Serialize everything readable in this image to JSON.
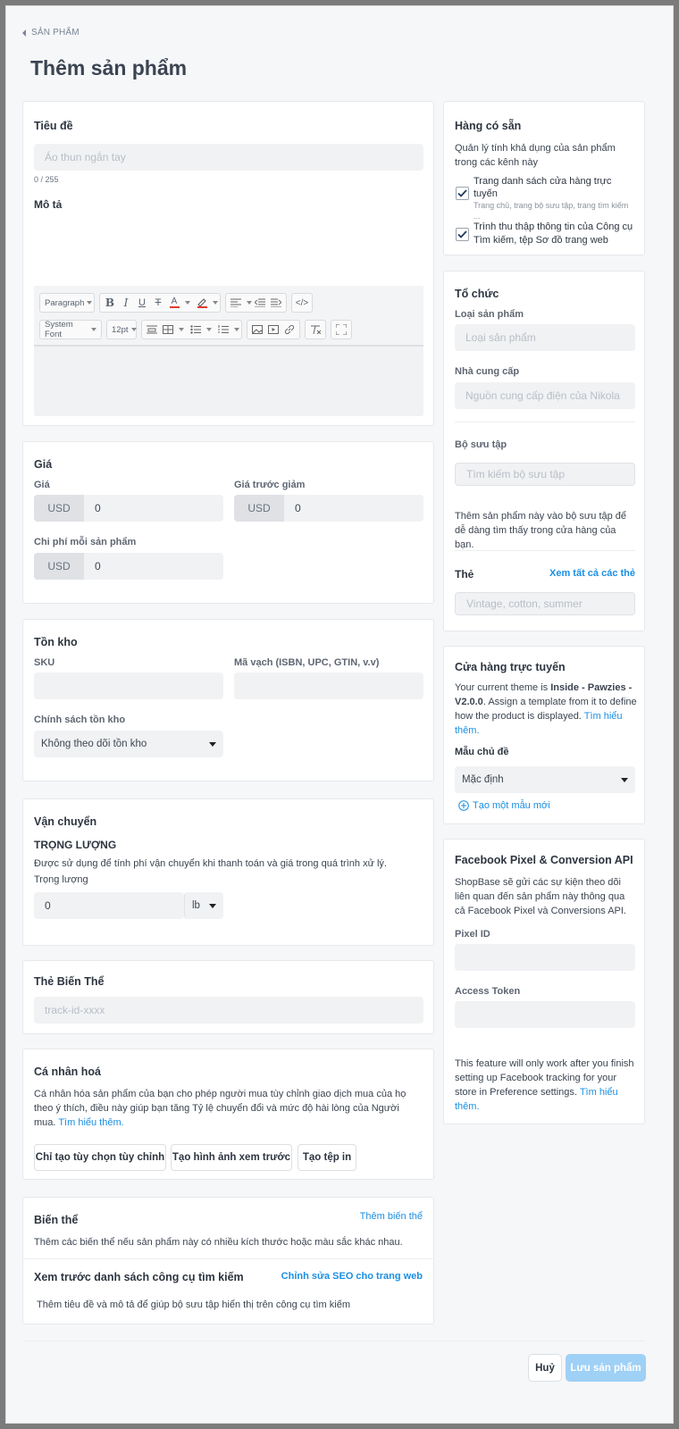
{
  "header": {
    "back_label": "SẢN PHẨM",
    "title": "Thêm sản phẩm"
  },
  "title_card": {
    "title_label": "Tiêu đề",
    "title_placeholder": "Áo thun ngắn tay",
    "char_count": "0 / 255",
    "description_label": "Mô tả",
    "toolbar": {
      "paragraph": "Paragraph",
      "font": "System Font",
      "size": "12pt"
    }
  },
  "pricing": {
    "heading": "Giá",
    "price_label": "Giá",
    "compare_label": "Giá trước giảm",
    "cost_label": "Chi phí mỗi sản phẩm",
    "currency": "USD",
    "price_value": "0",
    "compare_value": "0",
    "cost_value": "0"
  },
  "inventory": {
    "heading": "Tồn kho",
    "sku_label": "SKU",
    "barcode_label": "Mã vạch (ISBN, UPC, GTIN, v.v)",
    "policy_label": "Chính sách tồn kho",
    "policy_value": "Không theo dõi tồn kho"
  },
  "shipping": {
    "heading": "Vận chuyển",
    "weight_heading": "TRỌNG LƯỢNG",
    "help": "Được sử dụng để tính phí vận chuyển khi thanh toán và giá trong quá trình xử lý.",
    "weight_label": "Trọng lượng",
    "weight_value": "0",
    "unit": "lb"
  },
  "variant_tag": {
    "heading": "Thẻ Biến Thể",
    "placeholder": "track-id-xxxx"
  },
  "personalize": {
    "heading": "Cá nhân hoá",
    "text": "Cá nhân hóa sản phẩm của bạn cho phép người mua tùy chỉnh giao dịch mua của họ theo ý thích, điều này giúp bạn tăng Tỷ lệ chuyển đổi và mức độ hài lòng của Người mua.",
    "link": "Tìm hiểu thêm.",
    "btn_custom": "Chỉ tạo tùy chọn tùy chỉnh",
    "btn_preview": "Tạo hình ảnh xem trước",
    "btn_print": "Tạo tệp in"
  },
  "variants": {
    "heading": "Biến thể",
    "add_link": "Thêm biến thể",
    "text": "Thêm các biến thể nếu sản phẩm này có nhiều kích thước hoặc màu sắc khác nhau.",
    "seo_heading": "Xem trước danh sách công cụ tìm kiếm",
    "seo_link": "Chỉnh sửa SEO cho trang web",
    "seo_text": "Thêm tiêu đề và mô tả để giúp bộ sưu tập hiển thị trên công cụ tìm kiếm"
  },
  "availability": {
    "heading": "Hàng có sẵn",
    "text": "Quản lý tính khả dụng của sản phẩm trong các kênh này",
    "ch1_title": "Trang danh sách cửa hàng trực tuyến",
    "ch1_sub": "Trang chủ, trang bộ sưu tập, trang tìm kiếm ...",
    "ch2_title": "Trình thu thập thông tin của Công cụ Tìm kiếm, tệp Sơ đồ trang web"
  },
  "organization": {
    "heading": "Tổ chức",
    "type_label": "Loại sản phẩm",
    "type_placeholder": "Loại sản phẩm",
    "vendor_label": "Nhà cung cấp",
    "vendor_placeholder": "Nguồn cung cấp điện của Nikola",
    "collection_label": "Bộ sưu tập",
    "collection_placeholder": "Tìm kiếm bộ sưu tập",
    "collection_help": "Thêm sản phẩm này vào bộ sưu tập để dễ dàng tìm thấy trong cửa hàng của bạn.",
    "tags_label": "Thẻ",
    "tags_link": "Xem tất cả các thẻ",
    "tags_placeholder": "Vintage, cotton, summer"
  },
  "online_store": {
    "heading": "Cửa hàng trực tuyến",
    "text_a": "Your current theme is ",
    "theme": "Inside - Pawzies - V2.0.0",
    "text_b": ". Assign a template from it to define how the product is displayed. ",
    "link": "Tìm hiểu thêm.",
    "template_label": "Mẫu chủ đề",
    "template_value": "Mặc định",
    "create_link": "Tạo một mẫu mới"
  },
  "facebook": {
    "heading": "Facebook Pixel & Conversion API",
    "text": "ShopBase sẽ gửi các sự kiện theo dõi liên quan đến sản phẩm này thông qua cả Facebook Pixel và Conversions API.",
    "pixel_label": "Pixel ID",
    "token_label": "Access Token",
    "note": "This feature will only work after you finish setting up Facebook tracking for your store in Preference settings.",
    "note_link": "Tìm hiểu thêm."
  },
  "footer": {
    "cancel": "Huỷ",
    "save": "Lưu sản phẩm"
  },
  "colors": {
    "accent": "#1a8fe3",
    "save_bg": "#9fd0f5",
    "text_color_red": "#e23b2e"
  }
}
